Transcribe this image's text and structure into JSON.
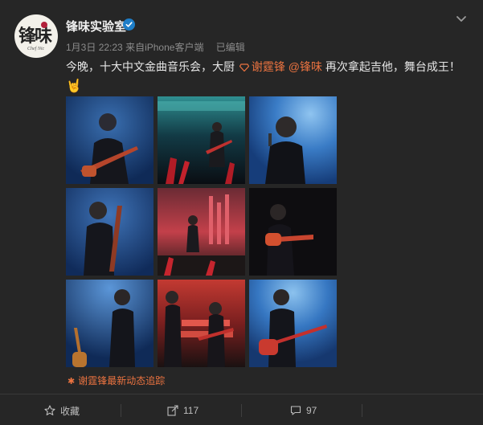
{
  "post": {
    "author": {
      "name": "锋味实验室",
      "avatar_text": "锋味",
      "avatar_subtext": "Chef Nic",
      "verified_color": "#1e7ec8"
    },
    "meta": {
      "date": "1月3日",
      "time": "22:23",
      "source": "来自iPhone客户端",
      "edited": "已编辑"
    },
    "text": {
      "prefix": "今晚，十大中文金曲音乐会，大厨",
      "mention_person": "谢霆锋",
      "mention_account": "@锋味",
      "suffix": "再次拿起吉他，舞台成王！"
    },
    "emoji": "🤘",
    "images": [
      {
        "name": "photo-1",
        "desc_theme": "blue"
      },
      {
        "name": "photo-2",
        "desc_theme": "teal"
      },
      {
        "name": "photo-3",
        "desc_theme": "blue-light"
      },
      {
        "name": "photo-4",
        "desc_theme": "blue"
      },
      {
        "name": "photo-5",
        "desc_theme": "red"
      },
      {
        "name": "photo-6",
        "desc_theme": "dark"
      },
      {
        "name": "photo-7",
        "desc_theme": "blue"
      },
      {
        "name": "photo-8",
        "desc_theme": "red"
      },
      {
        "name": "photo-9",
        "desc_theme": "blue-light"
      }
    ],
    "follow_link": "谢霆锋最新动态追踪"
  },
  "actions": {
    "favorite_label": "收藏",
    "forward_count": "117",
    "comment_count": "97"
  },
  "colors": {
    "accent": "#eb7340",
    "background": "#262626"
  }
}
